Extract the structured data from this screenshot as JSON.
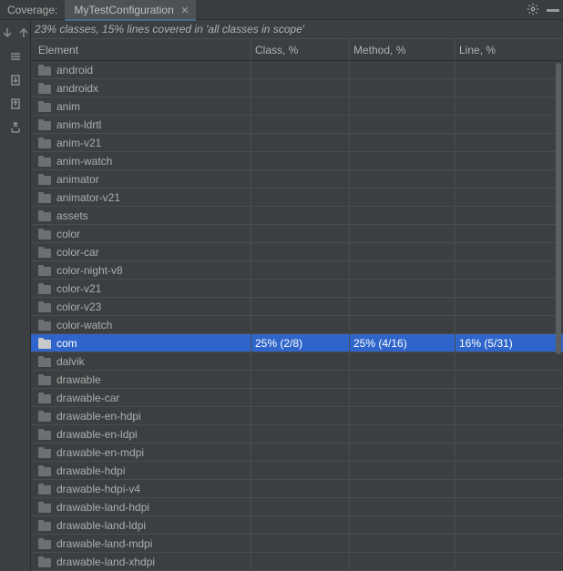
{
  "header": {
    "coverage_label": "Coverage:",
    "tab_name": "MyTestConfiguration"
  },
  "summary": "23% classes, 15% lines covered in 'all classes in scope'",
  "columns": {
    "element": "Element",
    "class": "Class, %",
    "method": "Method, %",
    "line": "Line, %"
  },
  "rows": [
    {
      "name": "android",
      "class": "",
      "method": "",
      "line": "",
      "selected": false
    },
    {
      "name": "androidx",
      "class": "",
      "method": "",
      "line": "",
      "selected": false
    },
    {
      "name": "anim",
      "class": "",
      "method": "",
      "line": "",
      "selected": false
    },
    {
      "name": "anim-ldrtl",
      "class": "",
      "method": "",
      "line": "",
      "selected": false
    },
    {
      "name": "anim-v21",
      "class": "",
      "method": "",
      "line": "",
      "selected": false
    },
    {
      "name": "anim-watch",
      "class": "",
      "method": "",
      "line": "",
      "selected": false
    },
    {
      "name": "animator",
      "class": "",
      "method": "",
      "line": "",
      "selected": false
    },
    {
      "name": "animator-v21",
      "class": "",
      "method": "",
      "line": "",
      "selected": false
    },
    {
      "name": "assets",
      "class": "",
      "method": "",
      "line": "",
      "selected": false
    },
    {
      "name": "color",
      "class": "",
      "method": "",
      "line": "",
      "selected": false
    },
    {
      "name": "color-car",
      "class": "",
      "method": "",
      "line": "",
      "selected": false
    },
    {
      "name": "color-night-v8",
      "class": "",
      "method": "",
      "line": "",
      "selected": false
    },
    {
      "name": "color-v21",
      "class": "",
      "method": "",
      "line": "",
      "selected": false
    },
    {
      "name": "color-v23",
      "class": "",
      "method": "",
      "line": "",
      "selected": false
    },
    {
      "name": "color-watch",
      "class": "",
      "method": "",
      "line": "",
      "selected": false
    },
    {
      "name": "com",
      "class": "25% (2/8)",
      "method": "25% (4/16)",
      "line": "16% (5/31)",
      "selected": true
    },
    {
      "name": "dalvik",
      "class": "",
      "method": "",
      "line": "",
      "selected": false
    },
    {
      "name": "drawable",
      "class": "",
      "method": "",
      "line": "",
      "selected": false
    },
    {
      "name": "drawable-car",
      "class": "",
      "method": "",
      "line": "",
      "selected": false
    },
    {
      "name": "drawable-en-hdpi",
      "class": "",
      "method": "",
      "line": "",
      "selected": false
    },
    {
      "name": "drawable-en-ldpi",
      "class": "",
      "method": "",
      "line": "",
      "selected": false
    },
    {
      "name": "drawable-en-mdpi",
      "class": "",
      "method": "",
      "line": "",
      "selected": false
    },
    {
      "name": "drawable-hdpi",
      "class": "",
      "method": "",
      "line": "",
      "selected": false
    },
    {
      "name": "drawable-hdpi-v4",
      "class": "",
      "method": "",
      "line": "",
      "selected": false
    },
    {
      "name": "drawable-land-hdpi",
      "class": "",
      "method": "",
      "line": "",
      "selected": false
    },
    {
      "name": "drawable-land-ldpi",
      "class": "",
      "method": "",
      "line": "",
      "selected": false
    },
    {
      "name": "drawable-land-mdpi",
      "class": "",
      "method": "",
      "line": "",
      "selected": false
    },
    {
      "name": "drawable-land-xhdpi",
      "class": "",
      "method": "",
      "line": "",
      "selected": false
    }
  ]
}
